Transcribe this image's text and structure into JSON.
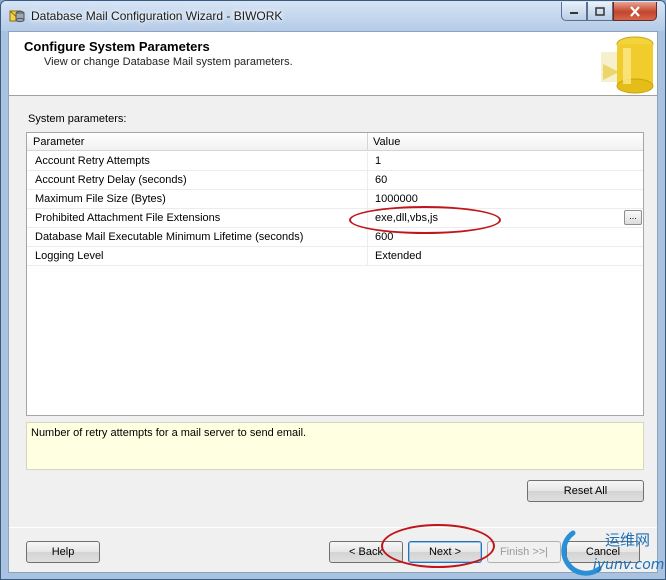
{
  "window": {
    "title": "Database Mail Configuration Wizard - BIWORK"
  },
  "header": {
    "title": "Configure System Parameters",
    "subtitle": "View or change Database Mail system parameters."
  },
  "section": {
    "label": "System parameters:"
  },
  "grid": {
    "columns": [
      "Parameter",
      "Value"
    ],
    "rows": [
      {
        "parameter": "Account Retry Attempts",
        "value": "1"
      },
      {
        "parameter": "Account Retry Delay (seconds)",
        "value": "60"
      },
      {
        "parameter": "Maximum File Size (Bytes)",
        "value": "1000000"
      },
      {
        "parameter": "Prohibited Attachment File Extensions",
        "value": "exe,dll,vbs,js"
      },
      {
        "parameter": "Database Mail Executable Minimum Lifetime (seconds)",
        "value": "600"
      },
      {
        "parameter": "Logging Level",
        "value": "Extended"
      }
    ],
    "ellipsis_label": "..."
  },
  "description": "Number of retry attempts for a mail server to send email.",
  "buttons": {
    "reset_all": "Reset All",
    "help": "Help",
    "back": "< Back",
    "next": "Next >",
    "finish": "Finish >>|",
    "cancel": "Cancel"
  },
  "watermark": {
    "line1": "运维网",
    "line2": "iyunv.com"
  },
  "colors": {
    "annotation": "#c0151b",
    "description_bg": "#ffffe1",
    "window_frame": "#a9c2e0"
  }
}
